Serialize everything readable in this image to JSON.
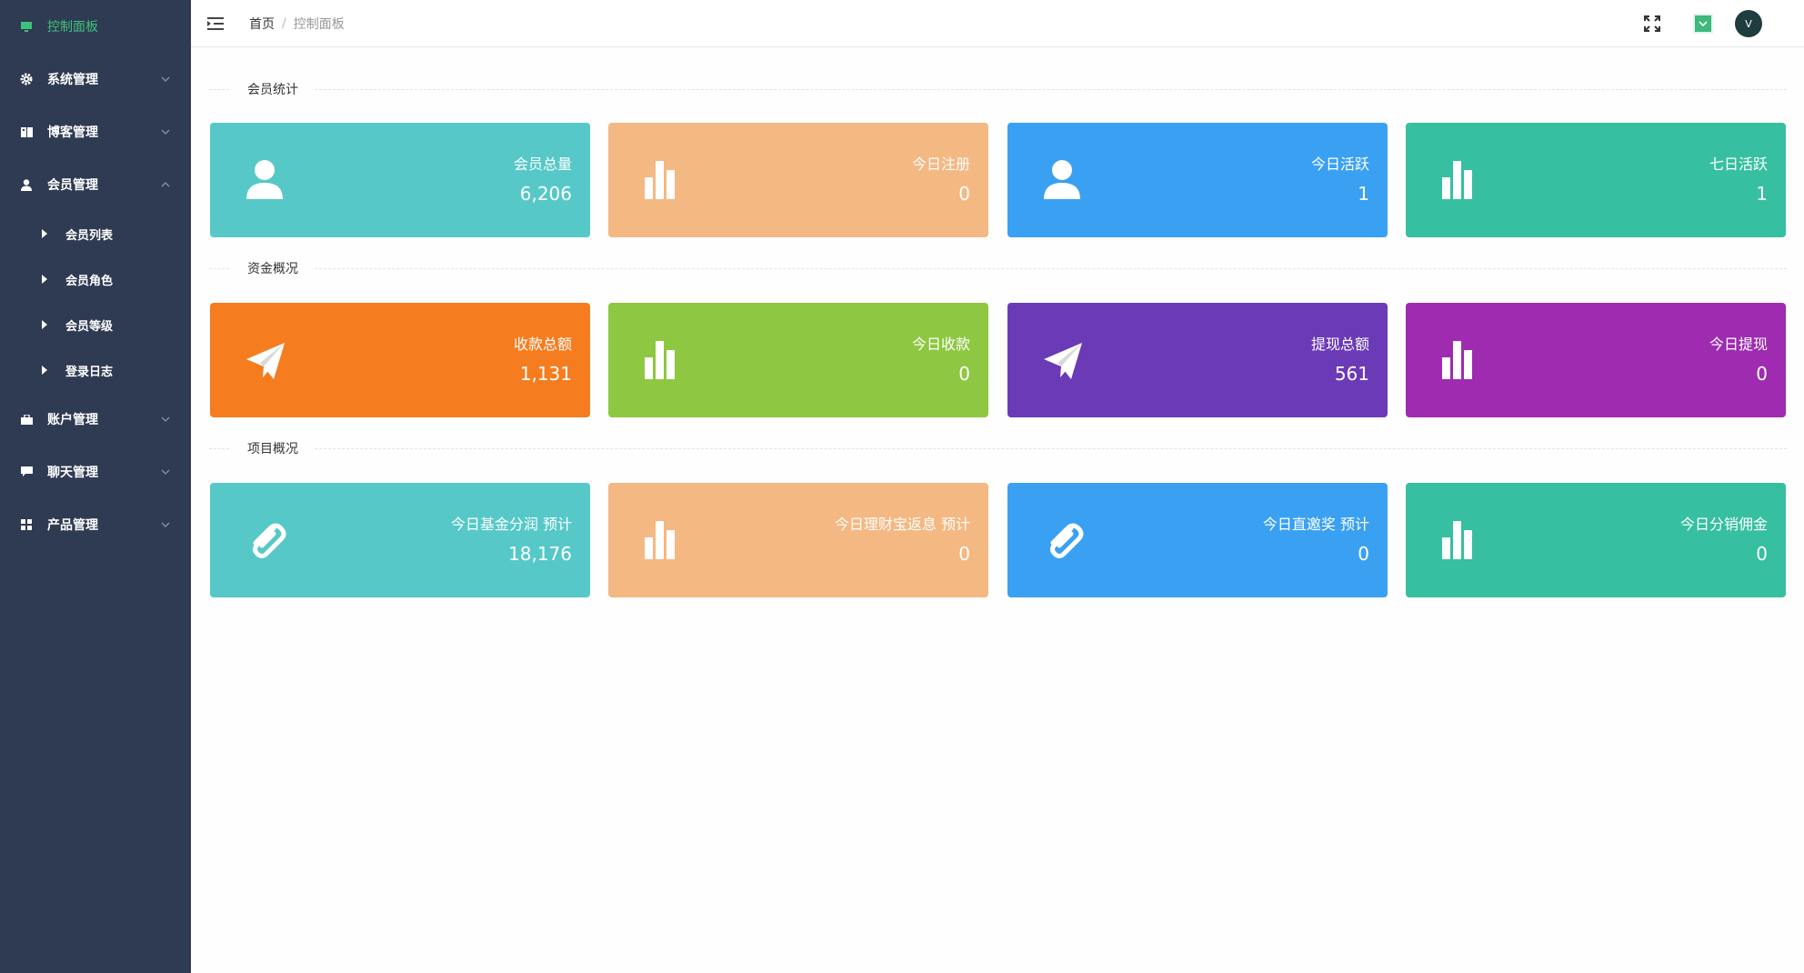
{
  "sidebar": {
    "items": [
      {
        "label": "控制面板",
        "icon": "monitor-icon",
        "active": true
      },
      {
        "label": "系统管理",
        "icon": "gear-icon"
      },
      {
        "label": "博客管理",
        "icon": "book-icon"
      },
      {
        "label": "会员管理",
        "icon": "user-icon",
        "expanded": true,
        "children": [
          {
            "label": "会员列表"
          },
          {
            "label": "会员角色"
          },
          {
            "label": "会员等级"
          },
          {
            "label": "登录日志"
          }
        ]
      },
      {
        "label": "账户管理",
        "icon": "briefcase-icon"
      },
      {
        "label": "聊天管理",
        "icon": "chat-icon"
      },
      {
        "label": "产品管理",
        "icon": "grid-icon"
      }
    ]
  },
  "header": {
    "breadcrumb_home": "首页",
    "breadcrumb_sep": "/",
    "breadcrumb_current": "控制面板",
    "avatar_text": "V"
  },
  "sections": [
    {
      "title": "会员统计",
      "cards": [
        {
          "label": "会员总量",
          "value": "6,206",
          "icon": "user-icon",
          "color": "#56c8c8"
        },
        {
          "label": "今日注册",
          "value": "0",
          "icon": "bar-chart-icon",
          "color": "#f4b883"
        },
        {
          "label": "今日活跃",
          "value": "1",
          "icon": "user-icon",
          "color": "#3aa1f2"
        },
        {
          "label": "七日活跃",
          "value": "1",
          "icon": "bar-chart-icon",
          "color": "#36bfa0"
        }
      ]
    },
    {
      "title": "资金概况",
      "cards": [
        {
          "label": "收款总额",
          "value": "1,131",
          "icon": "paper-plane-icon",
          "color": "#f57d20"
        },
        {
          "label": "今日收款",
          "value": "0",
          "icon": "bar-chart-icon",
          "color": "#8ec742"
        },
        {
          "label": "提现总额",
          "value": "561",
          "icon": "paper-plane-icon",
          "color": "#6b3ab6"
        },
        {
          "label": "今日提现",
          "value": "0",
          "icon": "bar-chart-icon",
          "color": "#9e2bb0"
        }
      ]
    },
    {
      "title": "项目概况",
      "cards": [
        {
          "label": "今日基金分润 预计",
          "value": "18,176",
          "icon": "paperclip-icon",
          "color": "#56c8c8"
        },
        {
          "label": "今日理财宝返息 预计",
          "value": "0",
          "icon": "bar-chart-icon",
          "color": "#f4b883"
        },
        {
          "label": "今日直邀奖 预计",
          "value": "0",
          "icon": "paperclip-icon",
          "color": "#3aa1f2"
        },
        {
          "label": "今日分销佣金",
          "value": "0",
          "icon": "bar-chart-icon",
          "color": "#36bfa0"
        }
      ]
    }
  ]
}
